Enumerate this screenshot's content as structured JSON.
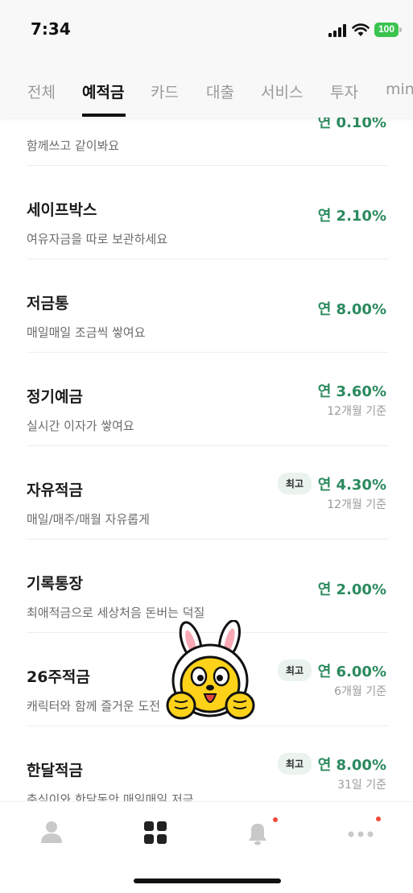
{
  "status_bar": {
    "time": "7:34",
    "battery": "100"
  },
  "tabs": [
    {
      "label": "전체"
    },
    {
      "label": "예적금"
    },
    {
      "label": "카드"
    },
    {
      "label": "대출"
    },
    {
      "label": "서비스"
    },
    {
      "label": "투자"
    },
    {
      "label": "mini"
    }
  ],
  "active_tab": "예적금",
  "products": [
    {
      "title": "",
      "desc": "함께쓰고 같이봐요",
      "rate": "연 0.10%",
      "basis": "",
      "badge": ""
    },
    {
      "title": "세이프박스",
      "desc": "여유자금을 따로 보관하세요",
      "rate": "연 2.10%",
      "basis": "",
      "badge": ""
    },
    {
      "title": "저금통",
      "desc": "매일매일 조금씩 쌓여요",
      "rate": "연 8.00%",
      "basis": "",
      "badge": ""
    },
    {
      "title": "정기예금",
      "desc": "실시간 이자가 쌓여요",
      "rate": "연 3.60%",
      "basis": "12개월 기준",
      "badge": ""
    },
    {
      "title": "자유적금",
      "desc": "매일/매주/매월 자유롭게",
      "rate": "연 4.30%",
      "basis": "12개월 기준",
      "badge": "최고"
    },
    {
      "title": "기록통장",
      "desc": "최애적금으로 세상처음 돈버는 덕질",
      "rate": "연 2.00%",
      "basis": "",
      "badge": ""
    },
    {
      "title": "26주적금",
      "desc": "캐릭터와 함께 즐거운 도전",
      "rate": "연 6.00%",
      "basis": "6개월 기준",
      "badge": "최고"
    },
    {
      "title": "한달적금",
      "desc": "춘식이와 한달동안 매일매일 저금",
      "rate": "연 8.00%",
      "basis": "31일 기준",
      "badge": "최고"
    }
  ],
  "bottom_nav": [
    {
      "icon": "person-icon"
    },
    {
      "icon": "grid-icon"
    },
    {
      "icon": "bell-icon"
    },
    {
      "icon": "more-icon"
    }
  ],
  "colors": {
    "rate_green": "#2b8a5e",
    "notify_red": "#f04a3a",
    "battery_green": "#3ac34f"
  }
}
